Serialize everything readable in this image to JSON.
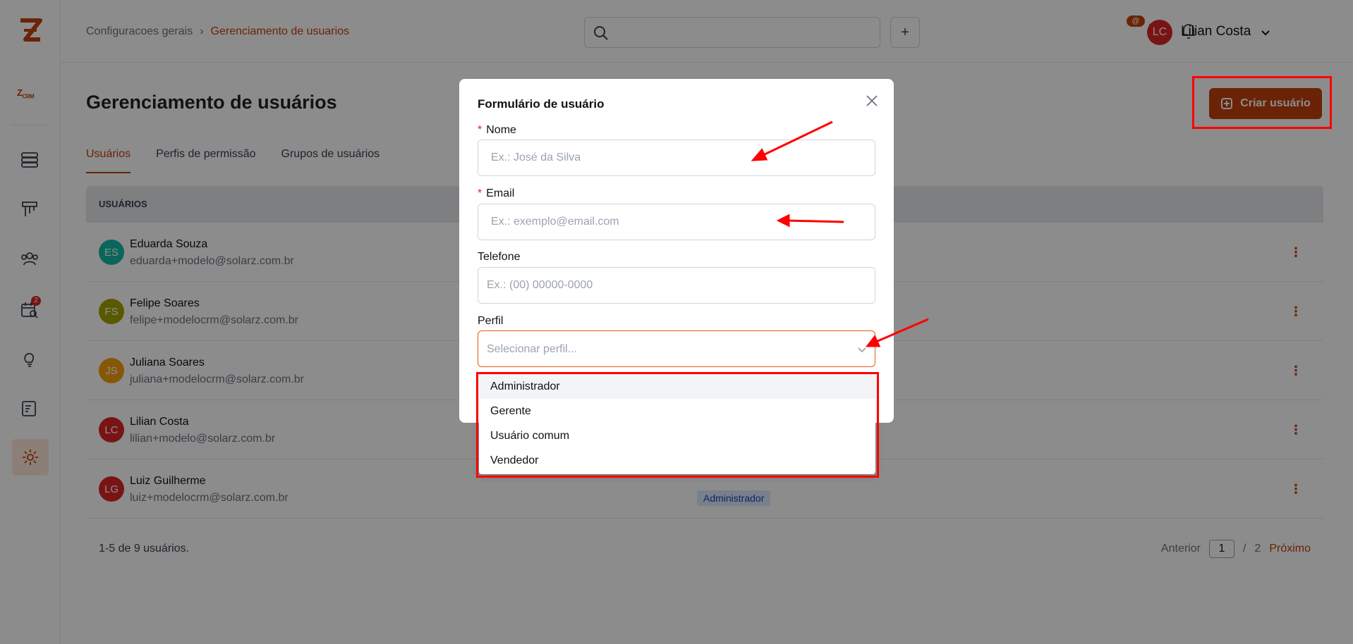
{
  "sidebar": {
    "logo_small": "Z",
    "logo_small_sub": "CRM",
    "badge": "2",
    "icons": [
      "servers-icon",
      "pipeline-icon",
      "users-icon",
      "calendar-search-icon",
      "lightbulb-icon",
      "notes-icon",
      "gear-icon"
    ]
  },
  "header": {
    "breadcrumb": {
      "parent": "Configuracoes gerais",
      "separator": "›",
      "current": "Gerenciamento de usuarios"
    },
    "search": {
      "placeholder": ""
    },
    "plus_label": "+",
    "notification_badge": "@",
    "user": {
      "initials": "LC",
      "name": "Lilian Costa",
      "avatar_color": "#dc2626"
    }
  },
  "main": {
    "title": "Gerenciamento de usuários",
    "create_button": "Criar usuário",
    "tabs": [
      {
        "label": "Usuários",
        "active": true
      },
      {
        "label": "Perfis de permissão",
        "active": false
      },
      {
        "label": "Grupos de usuários",
        "active": false
      }
    ],
    "table": {
      "header": "USUÁRIOS",
      "rows": [
        {
          "initials": "ES",
          "name": "Eduarda Souza",
          "email": "eduarda+modelo@solarz.com.br",
          "color": "#14b8a6",
          "role": ""
        },
        {
          "initials": "FS",
          "name": "Felipe Soares",
          "email": "felipe+modelocrm@solarz.com.br",
          "color": "#a3a300",
          "role": ""
        },
        {
          "initials": "JS",
          "name": "Juliana Soares",
          "email": "juliana+modelocrm@solarz.com.br",
          "color": "#f59e0b",
          "role": ""
        },
        {
          "initials": "LC",
          "name": "Lilian Costa",
          "email": "lilian+modelo@solarz.com.br",
          "color": "#dc2626",
          "role": ""
        },
        {
          "initials": "LG",
          "name": "Luiz Guilherme",
          "email": "luiz+modelocrm@solarz.com.br",
          "color": "#dc2626",
          "role": "Administrador"
        }
      ],
      "kebab": "⋮",
      "footer_count": "1-5 de 9 usuários.",
      "pager": {
        "prev": "Anterior",
        "page": "1",
        "sep": "/",
        "total": "2",
        "next": "Próximo"
      }
    }
  },
  "modal": {
    "title": "Formulário de usuário",
    "fields": {
      "nome": {
        "label": "Nome",
        "required_mark": "*",
        "placeholder": "Ex.: José da Silva"
      },
      "email": {
        "label": "Email",
        "required_mark": "*",
        "placeholder": "Ex.: exemplo@email.com"
      },
      "telefone": {
        "label": "Telefone",
        "placeholder": "Ex.: (00) 00000-0000"
      },
      "perfil": {
        "label": "Perfil",
        "placeholder": "Selecionar perfil..."
      }
    },
    "perfil_options": [
      "Administrador",
      "Gerente",
      "Usuário comum",
      "Vendedor"
    ]
  },
  "colors": {
    "accent": "#c2410c",
    "highlight": "#ff0000"
  }
}
